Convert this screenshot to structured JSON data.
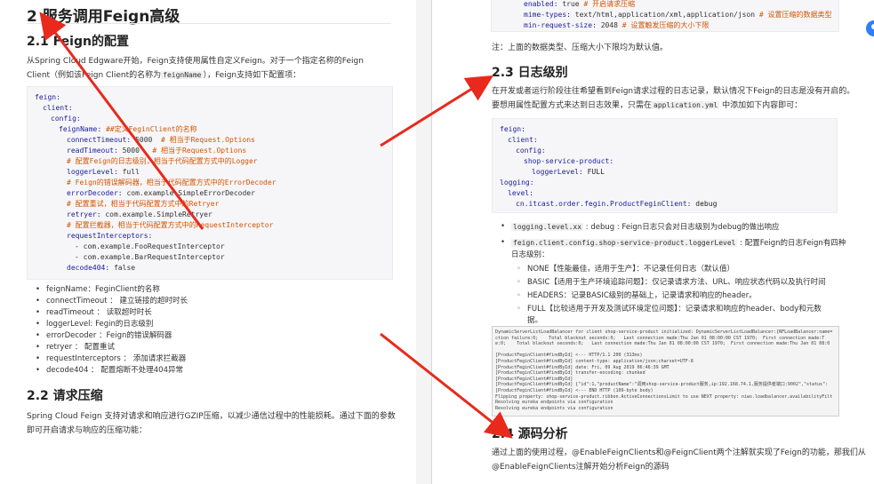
{
  "left": {
    "heading": "2 服务调用Feign高级",
    "section_21": "2.1 Feign的配置",
    "intro_line1": "从Spring Cloud Edgware开始，Feign支持使用属性自定义Feign。对于一个指定名称的Feign",
    "intro_line2_a": "Client（例如该Feign Client的名称为",
    "intro_line2_code": "feignName",
    "intro_line2_b": "），Feign支持如下配置项：",
    "code": [
      {
        "key": "feign:",
        "val": "",
        "kind": "k",
        "indent": 0
      },
      {
        "key": "client:",
        "val": "",
        "kind": "k",
        "indent": 1
      },
      {
        "key": "config:",
        "val": "",
        "kind": "k",
        "indent": 2
      },
      {
        "key": "feignName:",
        "val": " ##定义FeginClient的名称",
        "kind": "kc",
        "indent": 3
      },
      {
        "key": "connectTimeout:",
        "val": " 5000  # 相当于Request.Options",
        "kind": "kvc",
        "split": 6,
        "indent": 4
      },
      {
        "key": "readTimeout:",
        "val": " 5000   # 相当于Request.Options",
        "kind": "kvc",
        "split": 7,
        "indent": 4
      },
      {
        "key": "",
        "val": "# 配置Feign的日志级别，相当于代码配置方式中的Logger",
        "kind": "c",
        "indent": 4
      },
      {
        "key": "loggerLevel:",
        "val": " full",
        "kind": "kv",
        "indent": 4
      },
      {
        "key": "",
        "val": "# Feign的错误解码器，相当于代码配置方式中的ErrorDecoder",
        "kind": "c",
        "indent": 4
      },
      {
        "key": "errorDecoder:",
        "val": " com.example.SimpleErrorDecoder",
        "kind": "kv",
        "indent": 4
      },
      {
        "key": "",
        "val": "# 配置重试，相当于代码配置方式中的Retryer",
        "kind": "c",
        "indent": 4
      },
      {
        "key": "retryer:",
        "val": " com.example.SimpleRetryer",
        "kind": "kv",
        "indent": 4
      },
      {
        "key": "",
        "val": "# 配置拦截器，相当于代码配置方式中的RequestInterceptor",
        "kind": "c",
        "indent": 4
      },
      {
        "key": "requestInterceptors:",
        "val": "",
        "kind": "k",
        "indent": 4
      },
      {
        "key": "",
        "val": "- com.example.FooRequestInterceptor",
        "kind": "v",
        "indent": 5
      },
      {
        "key": "",
        "val": "- com.example.BarRequestInterceptor",
        "kind": "v",
        "indent": 5
      },
      {
        "key": "decode404:",
        "val": " false",
        "kind": "kv",
        "indent": 4
      }
    ],
    "bullets": [
      "feignName：FeginClient的名称",
      "connectTimeout ： 建立链接的超时时长",
      "readTimeout ： 读取超时时长",
      "loggerLevel: Fegin的日志级别",
      "errorDecoder ：Feign的错误解码器",
      "retryer ： 配置重试",
      "requestInterceptors ： 添加请求拦截器",
      "decode404 ： 配置熔断不处理404异常"
    ],
    "section_22": "2.2 请求压缩",
    "compress_line1": "Spring Cloud Feign 支持对请求和响应进行GZIP压缩，以减少通信过程中的性能损耗。通过下面的参数",
    "compress_line2": "即可开启请求与响应的压缩功能："
  },
  "right": {
    "top_code": [
      {
        "key": "enabled:",
        "val": " true # 开启请求压缩",
        "split": 5
      },
      {
        "key": "mime-types:",
        "val": " text/html,application/xml,application/json # 设置压缩的数据类型",
        "split": 43
      },
      {
        "key": "min-request-size:",
        "val": " 2048 # 设置触发压缩的大小下限",
        "split": 6
      }
    ],
    "note": "注：上面的数据类型、压缩大小下限均为默认值。",
    "section_23": "2.3 日志级别",
    "log_line1": "在开发或者运行阶段往往希望看到Feign请求过程的日志记录，默认情况下Feign的日志是没有开启的。",
    "log_line2_a": "要想用属性配置方式来达到日志效果，只需在",
    "log_line2_code": "application.yml",
    "log_line2_b": " 中添加如下内容即可：",
    "log_code": [
      {
        "text": "feign:",
        "indent": 0,
        "kind": "k"
      },
      {
        "text": "client:",
        "indent": 1,
        "kind": "k"
      },
      {
        "text": "config:",
        "indent": 2,
        "kind": "k"
      },
      {
        "text": "shop-service-product:",
        "indent": 3,
        "kind": "k"
      },
      {
        "text": "loggerLevel:",
        "val": " FULL",
        "indent": 4,
        "kind": "kv"
      },
      {
        "text": "logging:",
        "indent": 0,
        "kind": "k"
      },
      {
        "text": "level:",
        "indent": 1,
        "kind": "k"
      },
      {
        "text": "cn.itcast.order.fegin.ProductFeginClient:",
        "val": " debug",
        "indent": 2,
        "kind": "kv"
      }
    ],
    "bullet1_code": "logging.level.xx",
    "bullet1_text": " : debug : Feign日志只会对日志级别为debug的做出响应",
    "bullet2_code": "feign.client.config.shop-service-product.loggerLevel",
    "bullet2_text": " : 配置Feign的日志Feign有四种",
    "bullet2_text2": "日志级别：",
    "levels": [
      "NONE【性能最佳，适用于生产】：不记录任何日志（默认值）",
      "BASIC【适用于生产环境追踪问题】：仅记录请求方法、URL、响应状态代码以及执行时间",
      "HEADERS：记录BASIC级别的基础上，记录请求和响应的header。",
      "FULL【比较适用于开发及测试环境定位问题】：记录请求和响应的header、body和元数"
    ],
    "levels_wrap": "据。",
    "console_lines": [
      "DynamicServerListLoadBalancer for client shop-service-product initialized: DynamicServerListLoadBalancer:{NFLoadBalancer:name=",
      "ction failure:0;    Total blackout seconds:0;   Last connection made:Thu Jan 01 08:00:00 CST 1970;  First connection made:T",
      "e:0;    Total blackout seconds:0;   Last connection made:Thu Jan 01 08:00:00 CST 1970;  First connection made:Thu Jan 01 08:0",
      "",
      "[ProductFeginClient#findById] <--- HTTP/1.1 200 (313ms)",
      "[ProductFeginClient#findById] content-type: application/json;charset=UTF-8",
      "[ProductFeginClient#findById] date: Fri, 09 Aug 2019 06:46:39 GMT",
      "[ProductFeginClient#findById] transfer-encoding: chunked",
      "[ProductFeginClient#findById]",
      "[ProductFeginClient#findById] {\"id\":1,\"productName\":\"调用shop-service-product服务,ip:192.168.74.1,服务提供者端口:9002\",\"status\":",
      "[ProductFeginClient#findById] <--- END HTTP (109-byte body)",
      "Flipping property: shop-service-product.ribbon.ActiveConnectionsLimit to use NEXT property: niws.loadbalancer.availabilityFilt",
      "Resolving eureka endpoints via configuration",
      "Resolving eureka endpoints via configuration"
    ],
    "section_24": "2.4 源码分析",
    "source_line1": "通过上面的使用过程，@EnableFeignClients和@FeignClient两个注解就实现了Feign的功能，那我们从",
    "source_line2": "@EnableFeignClients注解开始分析Feign的源码"
  },
  "annotation_color": "#e8291c"
}
